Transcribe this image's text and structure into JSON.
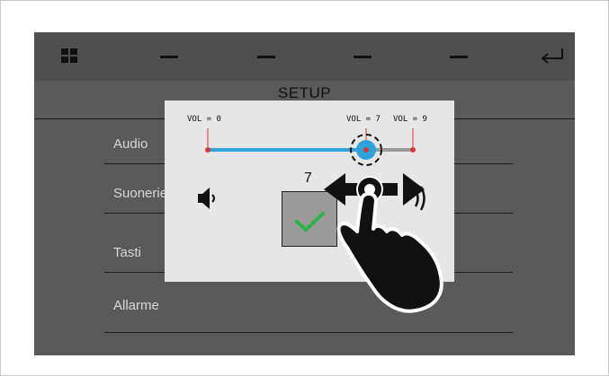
{
  "header": {
    "title": "SETUP",
    "home_icon": "grid-icon",
    "back_icon": "return-arrow-icon",
    "tab_icons": [
      "dash-icon",
      "dash-icon",
      "dash-icon",
      "dash-icon"
    ]
  },
  "menu": {
    "items": [
      {
        "label": "Audio"
      },
      {
        "label": "Suonerie"
      },
      {
        "label": "Tasti"
      },
      {
        "label": "Allarme"
      }
    ]
  },
  "volume_popup": {
    "min_label": "VOL = 0",
    "current_label": "VOL = 7",
    "max_label": "VOL = 9",
    "value": "7",
    "min": 0,
    "max": 9,
    "current": 7,
    "confirm_icon": "checkmark-icon",
    "speaker_low_icon": "speaker-low-icon",
    "speaker_high_icon": "speaker-high-icon"
  },
  "gesture": {
    "icon": "hand-drag-icon",
    "arrows_icon": "left-right-arrow-icon"
  },
  "colors": {
    "screen_bg": "#5a5a5a",
    "popup_bg": "#e6e6e6",
    "slider_fill": "#2ea3db",
    "slider_track": "#9a9a9a",
    "marker_red": "#d63a3a",
    "check_green": "#2bb34a"
  }
}
